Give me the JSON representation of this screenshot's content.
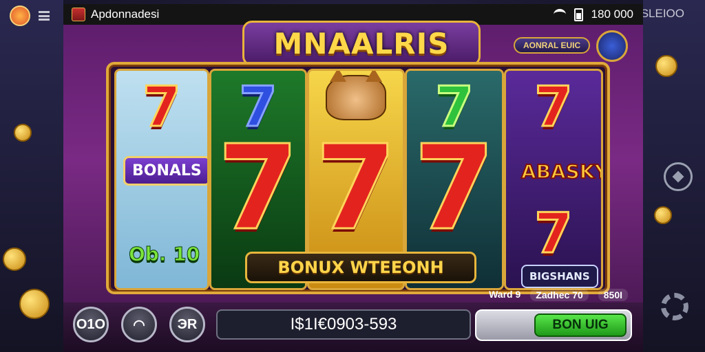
{
  "game": {
    "app_name": "Apdonnadesi",
    "status": "180 000",
    "title": "MNAALRIS",
    "info_pill": "AONRAL EUIC",
    "right_corner_text": "SLEIOO",
    "reel_tags": {
      "bonals": "BONALS",
      "bonus_ten": "Ob. 10",
      "bassy": "ABASKY!",
      "bigshans": "BIGSHANS"
    },
    "bonus_banner": "BONUX WTEEONH",
    "stats": {
      "wardg_label": "Ward 9",
      "zachec_label": "Zadhec 70",
      "value": "850I"
    },
    "controls": {
      "btn_1_label": "O1O",
      "btn_3_label": "ЭR",
      "balance": "I$1I€0903-593",
      "spin_label": "BON UIG"
    }
  },
  "colors": {
    "frame_gold": "#e0a93a",
    "spin_green": "#2fc23c",
    "seven_red": "#e3241e"
  }
}
